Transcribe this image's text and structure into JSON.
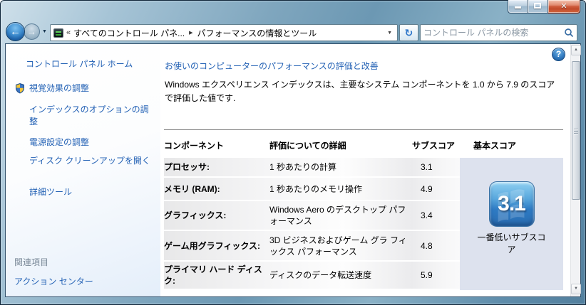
{
  "window_controls": {
    "minimize": "minimize",
    "maximize": "maximize",
    "close_glyph": "✕"
  },
  "toolbar": {
    "back_glyph": "←",
    "forward_glyph": "→",
    "recent_pages_caret": "▼",
    "address": {
      "chevron_left": "«",
      "breadcrumb_root": "すべてのコントロール パネ...",
      "separator_glyph": "▶",
      "breadcrumb_current": "パフォーマンスの情報とツール",
      "dropdown_caret": "▼"
    },
    "refresh_glyph": "↻",
    "search": {
      "placeholder": "コントロール パネルの検索"
    }
  },
  "sidebar": {
    "home_label": "コントロール パネル ホーム",
    "tasks": [
      {
        "label": "視覚効果の調整"
      },
      {
        "label": "インデックスのオプションの調整"
      },
      {
        "label": "電源設定の調整"
      },
      {
        "label": "ディスク クリーンアップを開く"
      },
      {
        "label": "詳細ツール"
      }
    ],
    "see_also_header": "関連項目",
    "see_also": [
      {
        "label": "アクション センター"
      }
    ]
  },
  "main": {
    "help_glyph": "?",
    "title": "お使いのコンピューターのパフォーマンスの評価と改善",
    "intro": "Windows エクスペリエンス インデックスは、主要なシステム コンポーネントを 1.0 から 7.9 のスコアで評価した値です.",
    "table": {
      "headers": [
        "コンポーネント",
        "評価についての詳細",
        "サブスコア",
        "基本スコア"
      ],
      "rows": [
        {
          "component": "プロセッサ:",
          "detail": "1 秒あたりの計算",
          "subscore": "3.1"
        },
        {
          "component": "メモリ (RAM):",
          "detail": "1 秒あたりのメモリ操作",
          "subscore": "4.9"
        },
        {
          "component": "グラフィックス:",
          "detail": "Windows Aero のデスクトップ パフォーマンス",
          "subscore": "3.4"
        },
        {
          "component": "ゲーム用グラフィックス:",
          "detail": "3D ビジネスおよびゲーム グラ フィックス パフォーマンス",
          "subscore": "4.8"
        },
        {
          "component": "プライマリ ハード ディスク:",
          "detail": "ディスクのデータ転送速度",
          "subscore": "5.9"
        }
      ],
      "base_score": {
        "value": "3.1",
        "caption": "一番低いサブスコア"
      }
    },
    "scrollbar": {
      "up_glyph": "▲",
      "down_glyph": "▼"
    }
  },
  "colors": {
    "link_blue": "#2462b5",
    "heading_blue": "#2462b5",
    "base_column_bg": "#dde2ee",
    "badge_blue": "#2e7bc4",
    "close_red": "#c14a2a",
    "aero_frame": "#6c98b3"
  }
}
